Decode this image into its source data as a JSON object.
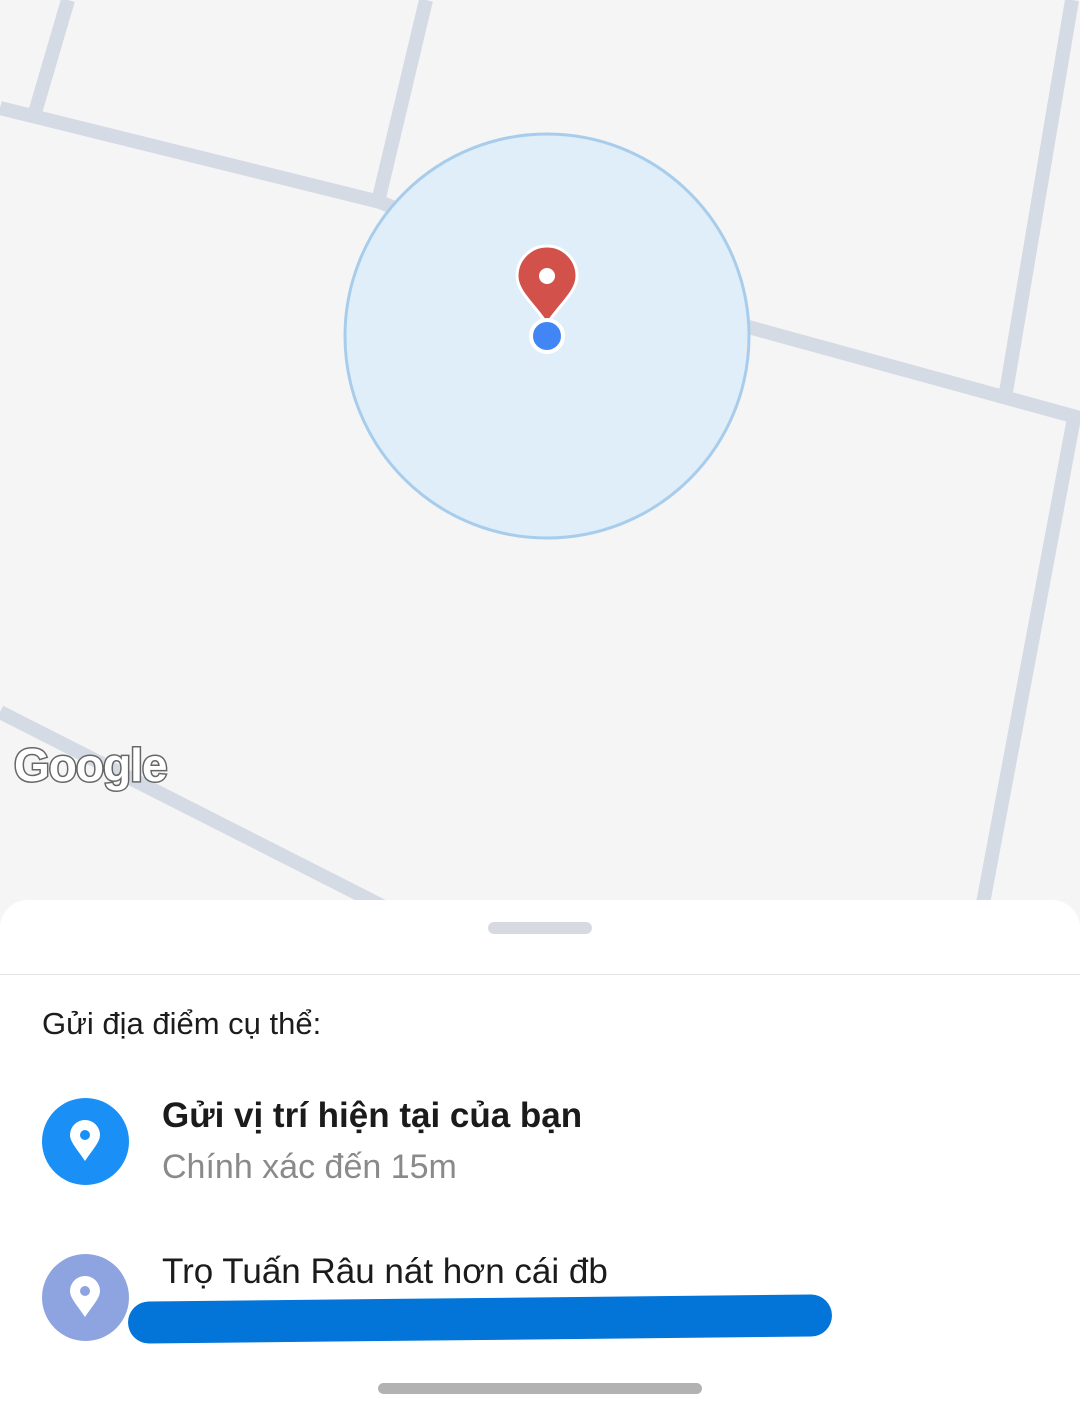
{
  "map": {
    "provider_logo": "Google",
    "accuracy_circle_color": "#dfeef8",
    "pin_color": "#d2514b",
    "current_location_dot_color": "#4285f4",
    "road_color": "#d4dbe5"
  },
  "sheet": {
    "section_title": "Gửi địa điểm cụ thể:",
    "items": [
      {
        "icon": "location-pin-icon",
        "icon_bg": "#1a8ff5",
        "title": "Gửi vị trí hiện tại của bạn",
        "subtitle": "Chính xác đến 15m"
      },
      {
        "icon": "location-pin-icon",
        "icon_bg": "#8da4e0",
        "title": "Trọ Tuấn Râu nát hơn cái đb",
        "subtitle": ""
      }
    ]
  }
}
